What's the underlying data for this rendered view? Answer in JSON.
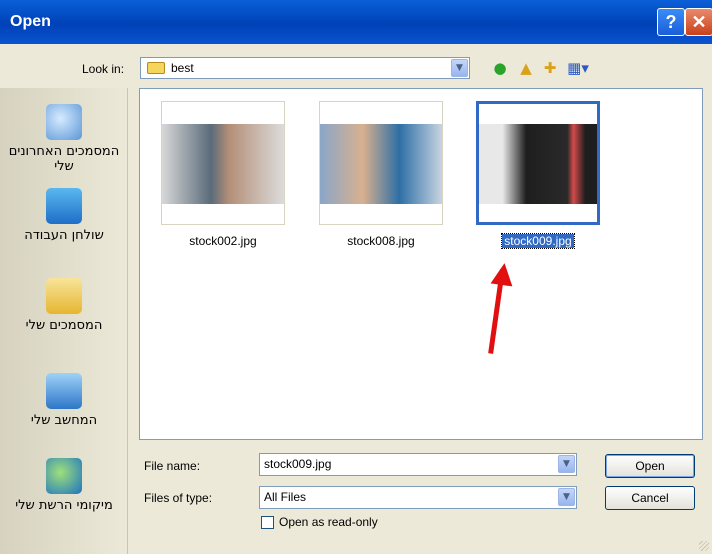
{
  "window": {
    "title": "Open",
    "help_label": "?",
    "close_label": "✕"
  },
  "toolbar": {
    "look_in_label": "Look in:",
    "look_in_value": "best",
    "icons": [
      "back-icon",
      "up-folder-icon",
      "new-folder-icon",
      "views-menu-icon"
    ]
  },
  "places": [
    {
      "label": "המסמכים האחרונים שלי",
      "icon": "recent-documents-icon"
    },
    {
      "label": "שולחן העבודה",
      "icon": "desktop-icon"
    },
    {
      "label": "המסמכים שלי",
      "icon": "my-documents-icon"
    },
    {
      "label": "המחשב שלי",
      "icon": "my-computer-icon"
    },
    {
      "label": "מיקומי הרשת שלי",
      "icon": "network-places-icon"
    }
  ],
  "files": [
    {
      "name": "stock002.jpg",
      "selected": false
    },
    {
      "name": "stock008.jpg",
      "selected": false
    },
    {
      "name": "stock009.jpg",
      "selected": true
    }
  ],
  "form": {
    "file_name_label": "File name:",
    "file_name_value": "stock009.jpg",
    "file_type_label": "Files of type:",
    "file_type_value": "All Files",
    "read_only_label": "Open as read-only",
    "read_only_checked": false
  },
  "buttons": {
    "open": "Open",
    "cancel": "Cancel"
  },
  "colors": {
    "title_bar": "#0a5fd8",
    "selection": "#316ac5",
    "annotation_arrow": "#e01010"
  }
}
